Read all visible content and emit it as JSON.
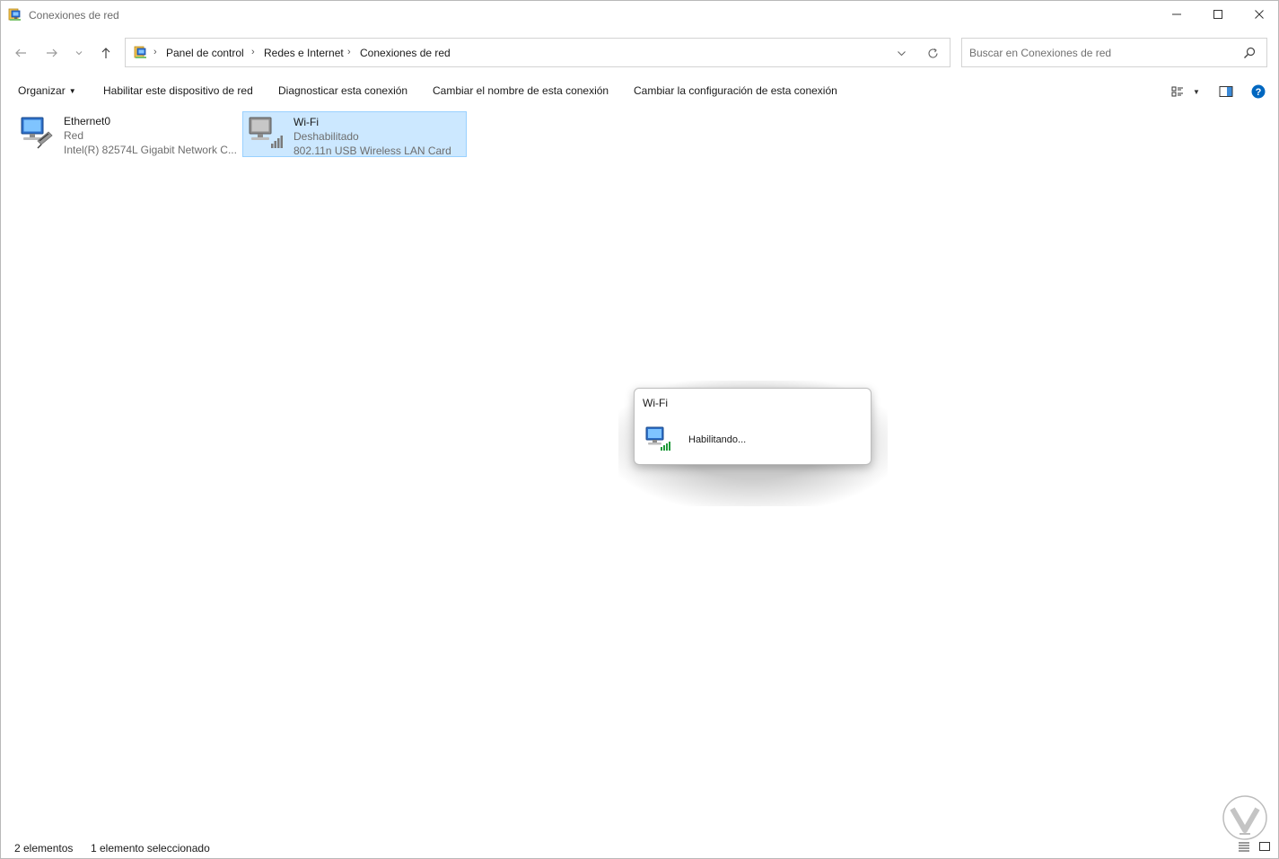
{
  "window": {
    "title": "Conexiones de red",
    "controls": {
      "minimize": "minimize-icon",
      "maximize": "maximize-icon",
      "close": "close-icon"
    }
  },
  "navigation": {
    "back": "arrow-left-icon",
    "forward": "arrow-right-icon",
    "recent": "chevron-down-icon",
    "up": "arrow-up-icon"
  },
  "address": {
    "breadcrumbs": [
      "Panel de control",
      "Redes e Internet",
      "Conexiones de red"
    ]
  },
  "search": {
    "placeholder": "Buscar en Conexiones de red"
  },
  "toolbar": {
    "organize": "Organizar",
    "enable": "Habilitar este dispositivo de red",
    "diagnose": "Diagnosticar esta conexión",
    "rename": "Cambiar el nombre de esta conexión",
    "settings": "Cambiar la configuración de esta conexión"
  },
  "connections": [
    {
      "name": "Ethernet0",
      "status": "Red",
      "device": "Intel(R) 82574L Gigabit Network C...",
      "selected": false
    },
    {
      "name": "Wi-Fi",
      "status": "Deshabilitado",
      "device": "802.11n USB Wireless LAN Card",
      "selected": true
    }
  ],
  "dialog": {
    "title": "Wi-Fi",
    "status": "Habilitando..."
  },
  "statusbar": {
    "count": "2 elementos",
    "selection": "1 elemento seleccionado"
  },
  "colors": {
    "selection_bg": "#cce8ff",
    "selection_border": "#99d1ff",
    "help_blue": "#0067c0"
  }
}
